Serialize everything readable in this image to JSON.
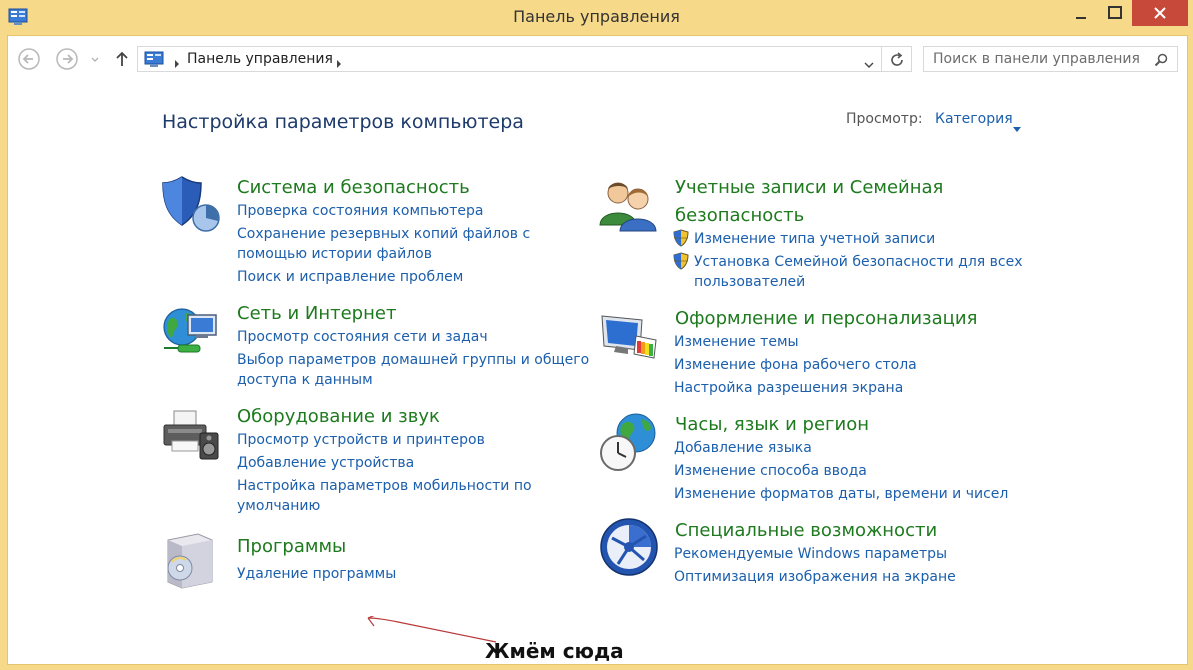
{
  "window": {
    "title": "Панель управления"
  },
  "addressbar": {
    "path": "Панель управления"
  },
  "search": {
    "placeholder": "Поиск в панели управления"
  },
  "header": {
    "title": "Настройка параметров компьютера",
    "view_label": "Просмотр:",
    "view_value": "Категория"
  },
  "categories": {
    "system": {
      "title": "Система и безопасность",
      "links": [
        "Проверка состояния компьютера",
        "Сохранение резервных копий файлов с",
        "помощью истории файлов",
        "Поиск и исправление проблем"
      ]
    },
    "network": {
      "title": "Сеть и Интернет",
      "links": [
        "Просмотр состояния сети и задач",
        "Выбор параметров домашней группы и общего",
        "доступа к данным"
      ]
    },
    "hardware": {
      "title": "Оборудование и звук",
      "links": [
        "Просмотр устройств и принтеров",
        "Добавление устройства",
        "Настройка параметров мобильности по",
        "умолчанию"
      ]
    },
    "programs": {
      "title": "Программы",
      "links": [
        "Удаление программы"
      ]
    },
    "accounts": {
      "title_line1": "Учетные записи и Семейная",
      "title_line2": "безопасность",
      "links": [
        "Изменение типа учетной записи",
        "Установка Семейной безопасности для всех",
        "пользователей"
      ]
    },
    "appearance": {
      "title": "Оформление и персонализация",
      "links": [
        "Изменение темы",
        "Изменение фона рабочего стола",
        "Настройка разрешения экрана"
      ]
    },
    "clock": {
      "title": "Часы, язык и регион",
      "links": [
        "Добавление языка",
        "Изменение способа ввода",
        "Изменение форматов даты, времени и чисел"
      ]
    },
    "access": {
      "title": "Специальные возможности",
      "links": [
        "Рекомендуемые Windows параметры",
        "Оптимизация изображения на экране"
      ]
    }
  },
  "annotation": {
    "text": "Жмём сюда"
  },
  "colors": {
    "frame": "#f7d98a",
    "close_button": "#c7493a",
    "category_title": "#1e7a1e",
    "link": "#1c5fac",
    "heading": "#1e3b6b"
  }
}
